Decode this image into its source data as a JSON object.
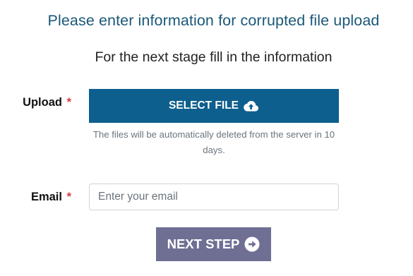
{
  "page": {
    "title": "Please enter information for corrupted file upload",
    "subtitle": "For the next stage fill in the information"
  },
  "upload": {
    "label": "Upload",
    "required_marker": "*",
    "button_label": "SELECT FILE",
    "button_icon": "cloud-upload-icon",
    "help_text": "The files will be automatically deleted from the server in 10 days."
  },
  "email": {
    "label": "Email",
    "required_marker": "*",
    "value": "",
    "placeholder": "Enter your email"
  },
  "next_step": {
    "label": "NEXT STEP",
    "icon": "arrow-circle-right-icon"
  },
  "colors": {
    "title": "#1a5878",
    "select_file_button": "#0d5f8e",
    "next_step_button": "#6e6f93",
    "required_marker": "#dc3545",
    "help_text": "#6c757d"
  }
}
